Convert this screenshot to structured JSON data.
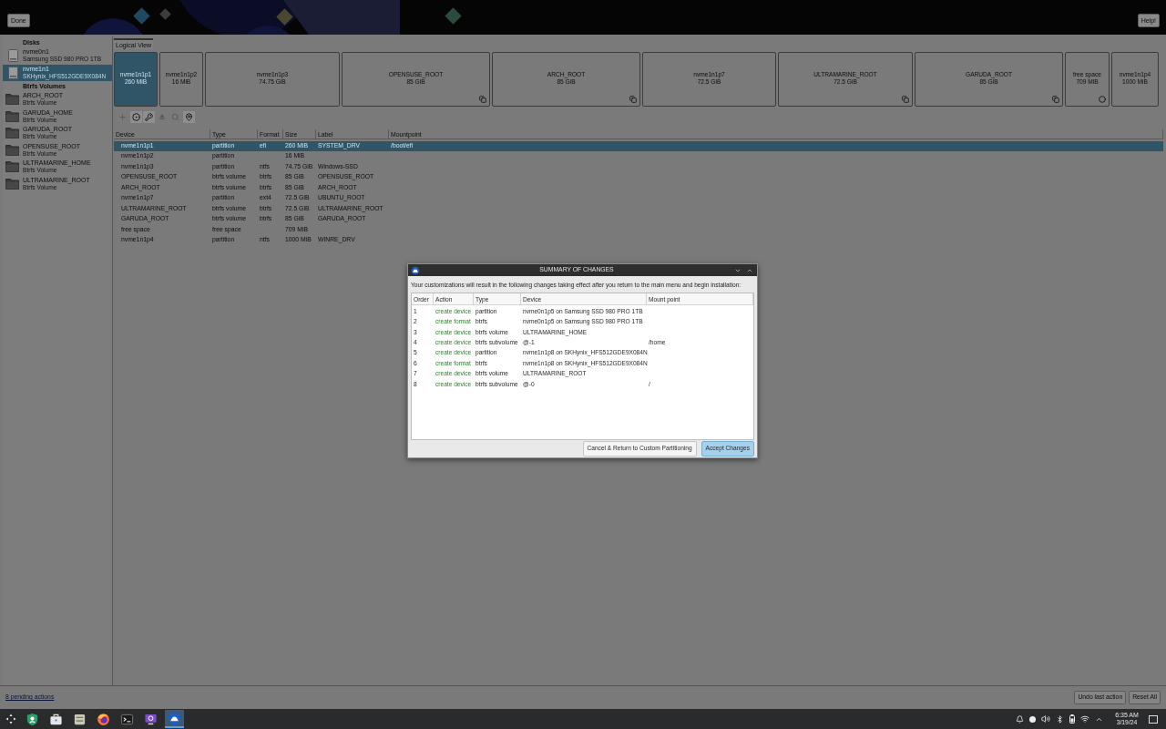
{
  "top_bar": {
    "done_button": "Done",
    "help_button": "Help!"
  },
  "sidebar": {
    "sections": [
      {
        "title": "Disks",
        "items": [
          {
            "kind": "disk",
            "name": "nvme0n1",
            "subtitle": "Samsung SSD 980 PRO 1TB",
            "selected": false
          },
          {
            "kind": "disk",
            "name": "nvme1n1",
            "subtitle": "SKHynix_HFS512GDE9X084N",
            "selected": true
          }
        ]
      },
      {
        "title": "Btrfs Volumes",
        "items": [
          {
            "kind": "volume",
            "name": "ARCH_ROOT",
            "subtitle": "Btrfs Volume",
            "selected": false
          },
          {
            "kind": "volume",
            "name": "GARUDA_HOME",
            "subtitle": "Btrfs Volume",
            "selected": false
          },
          {
            "kind": "volume",
            "name": "GARUDA_ROOT",
            "subtitle": "Btrfs Volume",
            "selected": false
          },
          {
            "kind": "volume",
            "name": "OPENSUSE_ROOT",
            "subtitle": "Btrfs Volume",
            "selected": false
          },
          {
            "kind": "volume",
            "name": "ULTRAMARINE_HOME",
            "subtitle": "Btrfs Volume",
            "selected": false
          },
          {
            "kind": "volume",
            "name": "ULTRAMARINE_ROOT",
            "subtitle": "Btrfs Volume",
            "selected": false
          }
        ]
      }
    ]
  },
  "view_tab": {
    "label": "Logical View",
    "selected": true
  },
  "partition_bar": [
    {
      "kind": "partition",
      "name": "nvme1n1p1",
      "size": "260 MiB",
      "selected": true
    },
    {
      "kind": "partition",
      "name": "nvme1n1p2",
      "size": "16 MiB",
      "selected": false
    },
    {
      "kind": "partition",
      "name": "nvme1n1p3",
      "size": "74.75 GiB",
      "selected": false
    },
    {
      "kind": "btrfs",
      "name": "OPENSUSE_ROOT",
      "size": "85 GiB",
      "selected": false
    },
    {
      "kind": "btrfs",
      "name": "ARCH_ROOT",
      "size": "85 GiB",
      "selected": false
    },
    {
      "kind": "partition",
      "name": "nvme1n1p7",
      "size": "72.5 GiB",
      "selected": false
    },
    {
      "kind": "btrfs",
      "name": "ULTRAMARINE_ROOT",
      "size": "72.5 GiB",
      "selected": false
    },
    {
      "kind": "btrfs",
      "name": "GARUDA_ROOT",
      "size": "85 GiB",
      "selected": false
    },
    {
      "kind": "free",
      "name": "free space",
      "size": "709 MiB",
      "selected": false
    },
    {
      "kind": "partition",
      "name": "nvme1n1p4",
      "size": "1000 MiB",
      "selected": false
    }
  ],
  "toolbar": [
    {
      "disabled": true
    },
    {
      "disabled": false
    },
    {
      "disabled": false
    },
    {
      "disabled": true
    },
    {
      "disabled": true
    },
    {
      "disabled": false
    }
  ],
  "devices_table": {
    "columns": [
      "Device",
      "Type",
      "Format",
      "Size",
      "Label",
      "Mountpoint"
    ],
    "rows": [
      {
        "device": "nvme1n1p1",
        "type": "partition",
        "format": "efi",
        "size": "260 MiB",
        "label": "SYSTEM_DRV",
        "mountpoint": "/boot/efi",
        "selected": true
      },
      {
        "device": "nvme1n1p2",
        "type": "partition",
        "size": "16 MiB",
        "selected": false
      },
      {
        "device": "nvme1n1p3",
        "type": "partition",
        "format": "ntfs",
        "size": "74.75 GiB",
        "label": "Windows-SSD",
        "selected": false
      },
      {
        "device": "OPENSUSE_ROOT",
        "type": "btrfs volume",
        "format": "btrfs",
        "size": "85 GiB",
        "label": "OPENSUSE_ROOT",
        "selected": false
      },
      {
        "device": "ARCH_ROOT",
        "type": "btrfs volume",
        "format": "btrfs",
        "size": "85 GiB",
        "label": "ARCH_ROOT",
        "selected": false
      },
      {
        "device": "nvme1n1p7",
        "type": "partition",
        "format": "ext4",
        "size": "72.5 GiB",
        "label": "UBUNTU_ROOT",
        "selected": false
      },
      {
        "device": "ULTRAMARINE_ROOT",
        "type": "btrfs volume",
        "format": "btrfs",
        "size": "72.5 GiB",
        "label": "ULTRAMARINE_ROOT",
        "selected": false
      },
      {
        "device": "GARUDA_ROOT",
        "type": "btrfs volume",
        "format": "btrfs",
        "size": "85 GiB",
        "label": "GARUDA_ROOT",
        "selected": false
      },
      {
        "device": "free space",
        "type": "free space",
        "size": "709 MiB",
        "selected": false
      },
      {
        "device": "nvme1n1p4",
        "type": "partition",
        "format": "ntfs",
        "size": "1000 MiB",
        "label": "WINRE_DRV",
        "selected": false
      }
    ]
  },
  "status_bar": {
    "pending_link": "8 pending actions",
    "buttons": [
      "Undo last action",
      "Reset All"
    ]
  },
  "dialog": {
    "title": "SUMMARY OF CHANGES",
    "message": "Your customizations will result in the following changes taking effect after you return to the main menu and begin installation:",
    "columns": [
      "Order",
      "Action",
      "Type",
      "Device",
      "Mount point"
    ],
    "rows": [
      {
        "order": "1",
        "action": "create device",
        "type": "partition",
        "device": "nvme0n1p5 on Samsung SSD 980 PRO 1TB"
      },
      {
        "order": "2",
        "action": "create format",
        "type": "btrfs",
        "device": "nvme0n1p5 on Samsung SSD 980 PRO 1TB"
      },
      {
        "order": "3",
        "action": "create device",
        "type": "btrfs volume",
        "device": "ULTRAMARINE_HOME"
      },
      {
        "order": "4",
        "action": "create device",
        "type": "btrfs subvolume",
        "device": "@-1",
        "mount_point": "/home"
      },
      {
        "order": "5",
        "action": "create device",
        "type": "partition",
        "device": "nvme1n1p8 on SKHynix_HFS512GDE9X084N"
      },
      {
        "order": "6",
        "action": "create format",
        "type": "btrfs",
        "device": "nvme1n1p8 on SKHynix_HFS512GDE9X084N"
      },
      {
        "order": "7",
        "action": "create device",
        "type": "btrfs volume",
        "device": "ULTRAMARINE_ROOT"
      },
      {
        "order": "8",
        "action": "create device",
        "type": "btrfs subvolume",
        "device": "@-0",
        "mount_point": "/"
      }
    ],
    "buttons": [
      {
        "label": "Cancel & Return to Custom Partitioning",
        "default": false
      },
      {
        "label": "Accept Changes",
        "default": true
      }
    ]
  },
  "taskbar": {
    "apps": [
      {
        "active": false
      },
      {
        "active": false
      },
      {
        "active": false
      },
      {
        "active": false
      },
      {
        "active": false
      },
      {
        "active": false
      },
      {
        "active": true
      }
    ],
    "clock": {
      "time": "6:35 AM",
      "date": "3/19/24"
    }
  }
}
